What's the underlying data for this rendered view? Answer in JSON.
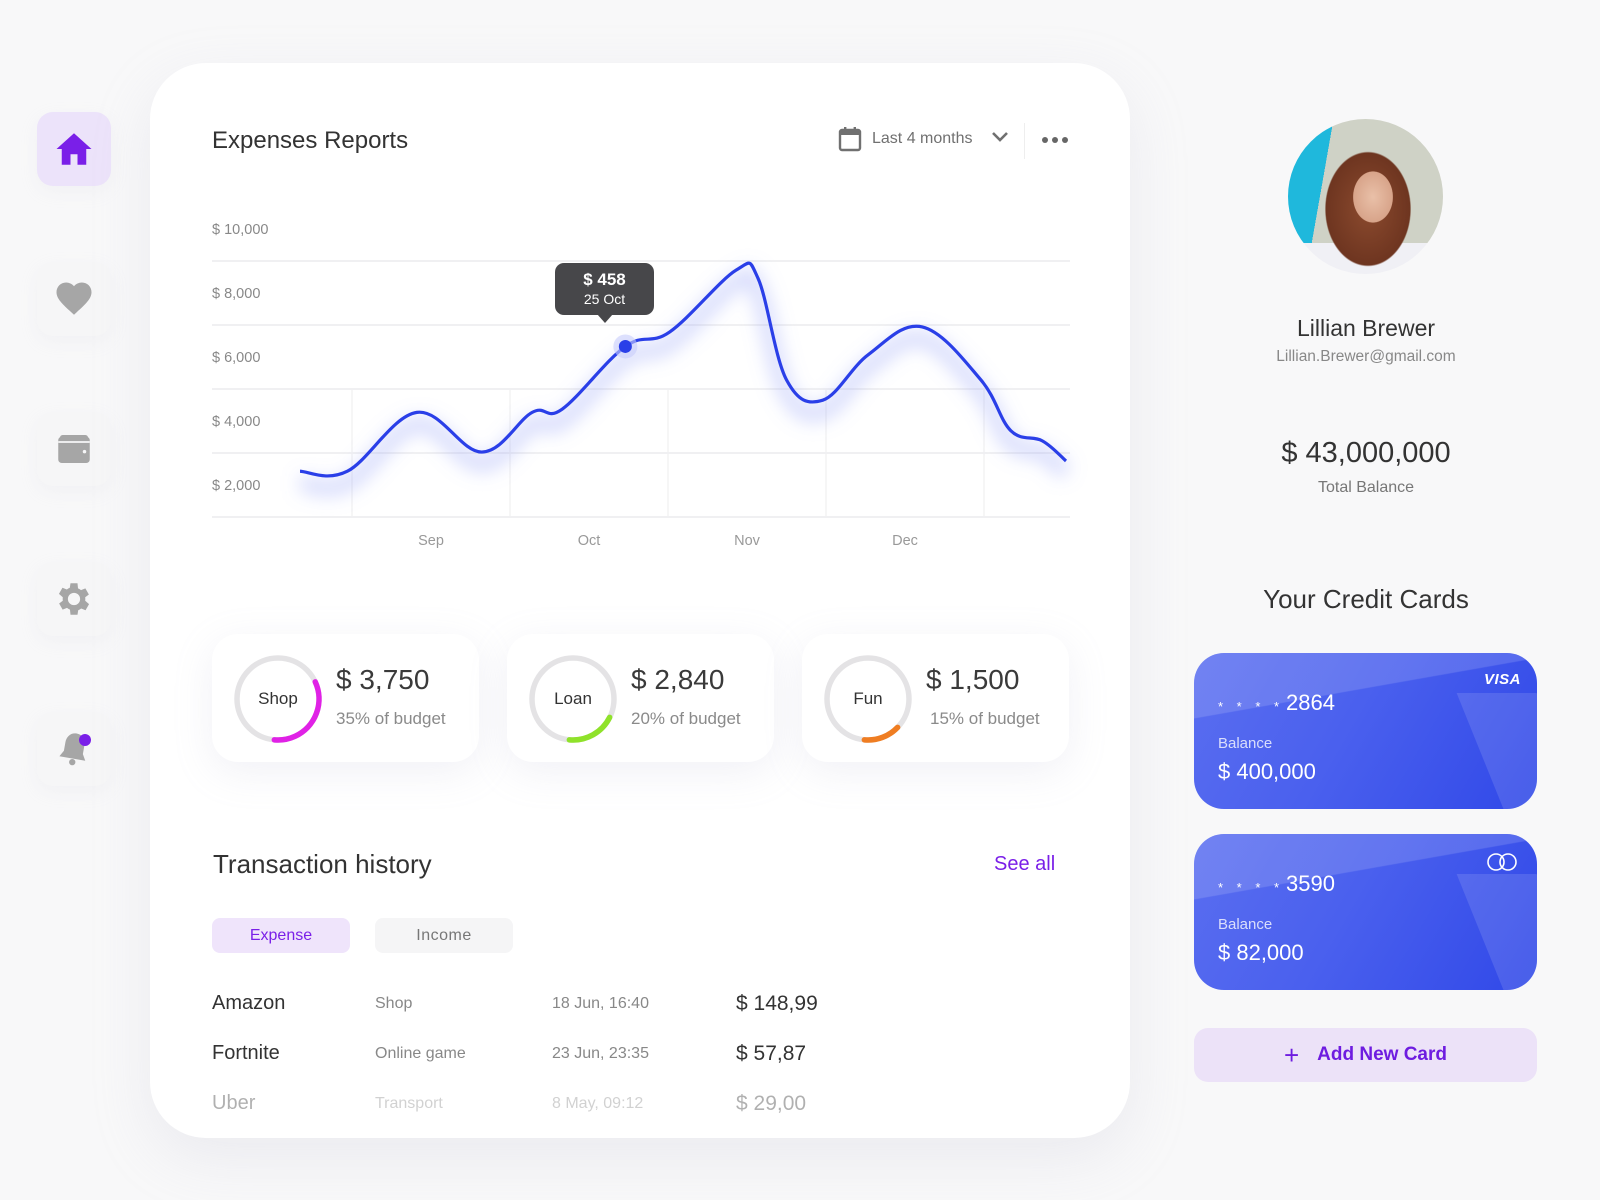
{
  "sidebar": {
    "items": [
      {
        "name": "home",
        "icon": "home-icon",
        "active": true
      },
      {
        "name": "favorites",
        "icon": "heart-icon",
        "active": false
      },
      {
        "name": "wallet",
        "icon": "wallet-icon",
        "active": false
      },
      {
        "name": "settings",
        "icon": "gear-icon",
        "active": false
      },
      {
        "name": "notifications",
        "icon": "bell-icon",
        "active": false,
        "has_badge": true
      }
    ]
  },
  "report": {
    "title": "Expenses Reports",
    "period_label": "Last 4 months",
    "tooltip": {
      "value": "$ 458",
      "date": "25 Oct"
    }
  },
  "chart_data": {
    "type": "line",
    "title": "Expenses Reports",
    "xlabel": "",
    "ylabel": "",
    "y_ticks": [
      "$ 10,000",
      "$ 8,000",
      "$ 6,000",
      "$ 4,000",
      "$ 2,000"
    ],
    "y_tick_values": [
      10000,
      8000,
      6000,
      4000,
      2000
    ],
    "x_ticks": [
      "Sep",
      "Oct",
      "Nov",
      "Dec"
    ],
    "ylim": [
      2000,
      10000
    ],
    "xlim": [
      0,
      4.85
    ],
    "grid": true,
    "series": [
      {
        "name": "Expenses",
        "color": "#2a3fe8",
        "x": [
          0.0,
          0.3,
          0.74,
          1.15,
          1.47,
          1.66,
          2.06,
          2.34,
          2.76,
          2.9,
          3.08,
          3.31,
          3.6,
          3.94,
          4.31,
          4.5,
          4.7,
          4.85
        ],
        "values": [
          3430,
          3430,
          5270,
          4030,
          5270,
          5370,
          7330,
          7780,
          9710,
          9460,
          6290,
          5650,
          7080,
          7940,
          6290,
          4700,
          4380,
          3750
        ]
      }
    ],
    "highlight": {
      "index": 6,
      "label": "$ 458",
      "date": "25 Oct"
    }
  },
  "budgets": [
    {
      "label": "Shop",
      "amount": "$ 3,750",
      "percent_text": "35% of budget",
      "fraction": 0.35,
      "color": "#e021e6"
    },
    {
      "label": "Loan",
      "amount": "$ 2,840",
      "percent_text": "20% of budget",
      "fraction": 0.2,
      "color": "#8fe22a"
    },
    {
      "label": "Fun",
      "amount": "$ 1,500",
      "percent_text": "15% of budget",
      "fraction": 0.15,
      "color": "#ef7d22"
    }
  ],
  "transactions": {
    "title": "Transaction history",
    "see_all": "See all",
    "tabs": [
      "Expense",
      "Income"
    ],
    "active_tab": "Expense",
    "rows": [
      {
        "name": "Amazon",
        "category": "Shop",
        "date": "18 Jun, 16:40",
        "amount": "$ 148,99"
      },
      {
        "name": "Fortnite",
        "category": "Online game",
        "date": "23 Jun, 23:35",
        "amount": "$ 57,87"
      },
      {
        "name": "Uber",
        "category": "Transport",
        "date": "8 May, 09:12",
        "amount": "$ 29,00"
      }
    ]
  },
  "profile": {
    "name": "Lillian Brewer",
    "email": "Lillian.Brewer@gmail.com",
    "total_balance": "$ 43,000,000",
    "total_balance_label": "Total Balance"
  },
  "cards": {
    "title": "Your Credit Cards",
    "items": [
      {
        "masked": "* * * *",
        "last4": "2864",
        "balance_label": "Balance",
        "balance": "$ 400,000",
        "brand": "VISA"
      },
      {
        "masked": "* * * *",
        "last4": "3590",
        "balance_label": "Balance",
        "balance": "$ 82,000",
        "brand": "Mastercard"
      }
    ],
    "add_label": "Add New Card",
    "add_icon": "+"
  },
  "colors": {
    "accent": "#7a1fe8",
    "line": "#2a3fe8",
    "card_blue": "#4a60ee"
  }
}
